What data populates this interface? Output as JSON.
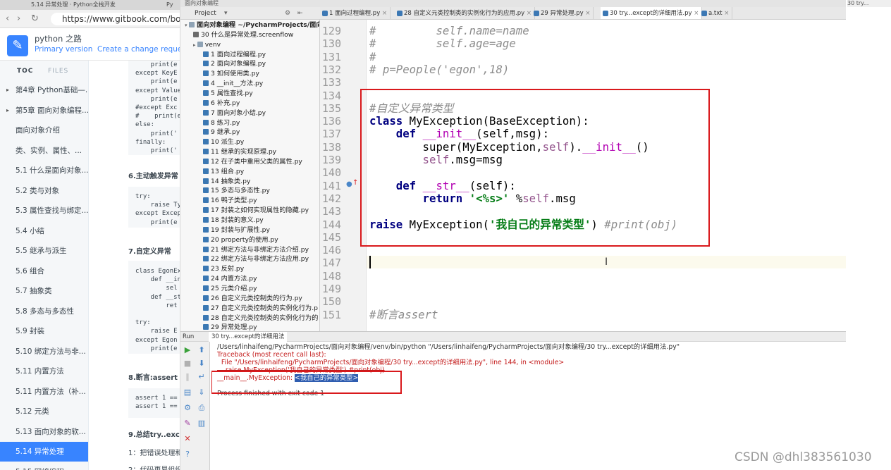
{
  "browser": {
    "tabs": [
      "5.14 异常处理 · Python全栈开发",
      "Py"
    ],
    "url": "https://www.gitbook.com/book/triac",
    "book_title": "python 之路",
    "version_label": "Primary version",
    "change_request": "Create a change request",
    "toc_tabs": [
      "TOC",
      "FILES"
    ],
    "toc_items": [
      {
        "label": "第4章 Python基础—...",
        "arrow": true
      },
      {
        "label": "第5章 面向对象编程...",
        "arrow": true
      },
      {
        "label": "面向对象介绍"
      },
      {
        "label": "类、实例、属性、..."
      },
      {
        "label": "5.1 什么是面向对象..."
      },
      {
        "label": "5.2 类与对象"
      },
      {
        "label": "5.3 属性查找与绑定..."
      },
      {
        "label": "5.4 小结"
      },
      {
        "label": "5.5 继承与派生"
      },
      {
        "label": "5.6 组合"
      },
      {
        "label": "5.7 抽象类"
      },
      {
        "label": "5.8 多态与多态性"
      },
      {
        "label": "5.9 封装"
      },
      {
        "label": "5.10 绑定方法与非..."
      },
      {
        "label": "5.11 内置方法"
      },
      {
        "label": "5.11 内置方法（补..."
      },
      {
        "label": "5.12 元类"
      },
      {
        "label": "5.13 面向对象的软..."
      },
      {
        "label": "5.14 异常处理",
        "active": true
      },
      {
        "label": "5.15 网络编程..."
      }
    ],
    "article": {
      "code1": "    print(e\nexcept KeyE\n    print(e\nexcept Value\n    print(e\n#except Exc\n#    print(e\nelse:\n    print('\nfinally:\n    print('",
      "h6": "6.主动触发异常",
      "code2": "try:\n    raise Ty\nexcept Excep\n    print(e",
      "h7": "7.自定义异常",
      "code3": "class EgonEx\n    def __in\n        sel\n    def __st\n        ret\n\ntry:\n    raise E\nexcept Egon\n    print(e",
      "h8": "8.断言:assert 条",
      "code4": "assert 1 ==\nassert 1 ==",
      "h9": "9.总结try..excep",
      "p1": "1：把错误处理和",
      "p2": "2：代码更易组织"
    }
  },
  "ide": {
    "title_bar": "面向对象编程",
    "project_label": "Project",
    "tabs": [
      {
        "label": "1 面向过程编程.py"
      },
      {
        "label": "28 自定义元类控制类的实例化行为的应用.py"
      },
      {
        "label": "29 异常处理.py"
      },
      {
        "label": "30 try...except的详细用法.py",
        "active": true
      },
      {
        "label": "a.txt"
      }
    ],
    "tree": [
      {
        "label": "面向对象编程  ~/PycharmProjects/面向",
        "type": "dir",
        "indent": 0,
        "bold": true
      },
      {
        "label": "30 什么是异常处理.screenflow",
        "type": "sf",
        "indent": 1
      },
      {
        "label": "venv",
        "type": "dir",
        "indent": 1
      },
      {
        "label": "1 面向过程编程.py",
        "type": "py",
        "indent": 2
      },
      {
        "label": "2 面向对象编程.py",
        "type": "py",
        "indent": 2
      },
      {
        "label": "3 如何使用类.py",
        "type": "py",
        "indent": 2
      },
      {
        "label": "4 __init__方法.py",
        "type": "py",
        "indent": 2
      },
      {
        "label": "5 属性查找.py",
        "type": "py",
        "indent": 2
      },
      {
        "label": "6 补充.py",
        "type": "py",
        "indent": 2
      },
      {
        "label": "7 面向对象小结.py",
        "type": "py",
        "indent": 2
      },
      {
        "label": "8 练习.py",
        "type": "py",
        "indent": 2
      },
      {
        "label": "9 继承.py",
        "type": "py",
        "indent": 2
      },
      {
        "label": "10 派生.py",
        "type": "py",
        "indent": 2
      },
      {
        "label": "11 继承的实现原理.py",
        "type": "py",
        "indent": 2
      },
      {
        "label": "12 在子类中重用父类的属性.py",
        "type": "py",
        "indent": 2
      },
      {
        "label": "13 组合.py",
        "type": "py",
        "indent": 2
      },
      {
        "label": "14 抽象类.py",
        "type": "py",
        "indent": 2
      },
      {
        "label": "15 多态与多态性.py",
        "type": "py",
        "indent": 2
      },
      {
        "label": "16 鸭子类型.py",
        "type": "py",
        "indent": 2
      },
      {
        "label": "17 封装之如何实现属性的隐藏.py",
        "type": "py",
        "indent": 2
      },
      {
        "label": "18 封装的意义.py",
        "type": "py",
        "indent": 2
      },
      {
        "label": "19 封装与扩展性.py",
        "type": "py",
        "indent": 2
      },
      {
        "label": "20 property的使用.py",
        "type": "py",
        "indent": 2
      },
      {
        "label": "21 绑定方法与非绑定方法介绍.py",
        "type": "py",
        "indent": 2
      },
      {
        "label": "22 绑定方法与非绑定方法应用.py",
        "type": "py",
        "indent": 2
      },
      {
        "label": "23 反射.py",
        "type": "py",
        "indent": 2
      },
      {
        "label": "24 内置方法.py",
        "type": "py",
        "indent": 2
      },
      {
        "label": "25 元类介绍.py",
        "type": "py",
        "indent": 2
      },
      {
        "label": "26 自定义元类控制类的行为.py",
        "type": "py",
        "indent": 2
      },
      {
        "label": "27 自定义元类控制类的实例化行为.p",
        "type": "py",
        "indent": 2
      },
      {
        "label": "28 自定义元类控制类的实例化行为的",
        "type": "py",
        "indent": 2
      },
      {
        "label": "29 异常处理.py",
        "type": "py",
        "indent": 2
      }
    ],
    "line_numbers": [
      "129",
      "130",
      "131",
      "132",
      "133",
      "134",
      "135",
      "136",
      "137",
      "138",
      "139",
      "140",
      "141",
      "142",
      "143",
      "144",
      "145",
      "146",
      "147",
      "148",
      "149",
      "150",
      "151"
    ],
    "code": {
      "l129": "#         self.name=name",
      "l130": "#         self.age=age",
      "l131": "#",
      "l132": "# p=People('egon',18)",
      "l135": "#自定义异常类型",
      "l136_kw": "class ",
      "l136_name": "MyException",
      "l136_rest": "(BaseException):",
      "l137_kw": "    def ",
      "l137_name": "__init__",
      "l137_rest": "(self,msg):",
      "l138_a": "        super(MyException,",
      "l138_self": "self",
      "l138_b": ").",
      "l138_init": "__init__",
      "l138_c": "()",
      "l139_self": "        self",
      "l139_rest": ".msg=msg",
      "l141_kw": "    def ",
      "l141_name": "__str__",
      "l141_rest": "(self):",
      "l142_kw": "        return ",
      "l142_str": "'<%s>'",
      "l142_mid": " %",
      "l142_self": "self",
      "l142_rest": ".msg",
      "l144_kw": "raise ",
      "l144_mid": "MyException(",
      "l144_str": "'我自己的异常类型'",
      "l144_end": ") ",
      "l144_cm": "#print(obj)",
      "l151": "#断言assert"
    },
    "run": {
      "label": "Run",
      "tab": "30 try...except的详细用法",
      "lines": {
        "cmd": "/Users/linhaifeng/PycharmProjects/面向对象编程/venv/bin/python \"/Users/linhaifeng/PycharmProjects/面向对象编程/30 try...except的详细用法.py\"",
        "tb": "Traceback (most recent call last):",
        "file_a": "  File \"",
        "file_link": "/Users/linhaifeng/PycharmProjects/面向对象编程/30 try...except的详细用法.py",
        "file_b": "\", line 144, in <module>",
        "raise": "    raise MyException('我自己的异常类型') #print(obj)",
        "exc_name": "__main__.MyException: ",
        "exc_msg": "<我自己的异常类型>",
        "finished": "Process finished with exit code 1"
      }
    }
  },
  "right_tab": "30 try...",
  "watermark": "CSDN @dhl383561030",
  "colors": {
    "accent": "#3884ff",
    "highlight_box": "#d9191c",
    "keyword": "#000080",
    "string": "#067d17"
  }
}
